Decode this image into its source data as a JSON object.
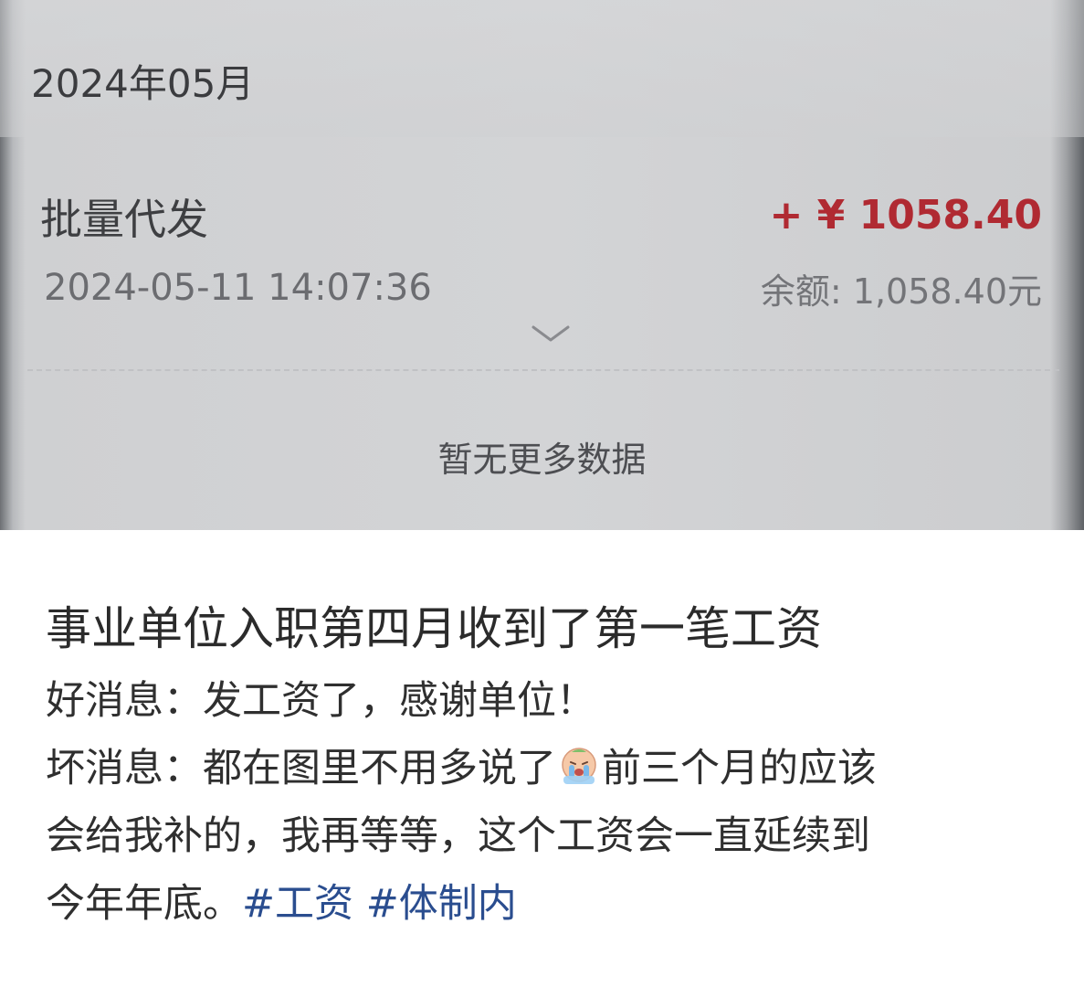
{
  "screenshot": {
    "month_header": "2024年05月",
    "transaction": {
      "title": "批量代发",
      "datetime": "2024-05-11 14:07:36",
      "amount": "+ ¥ 1058.40",
      "balance": "余额: 1,058.40元",
      "amount_color": "#b02a32"
    },
    "expand_icon": "chevron-down-icon",
    "end_message": "暂无更多数据"
  },
  "post": {
    "title": "事业单位入职第四月收到了第一笔工资",
    "line1": "好消息：发工资了，感谢单位！",
    "line2_a": "坏消息：都在图里不用多说了",
    "emoji_icon": "crying-face-icon",
    "line2_b": "前三个月的应该",
    "line3": "会给我补的，我再等等，这个工资会一直延续到",
    "line4": "今年年底。",
    "hashtags": [
      "#工资",
      "#体制内"
    ],
    "hashtag_color": "#2a4d8f"
  }
}
